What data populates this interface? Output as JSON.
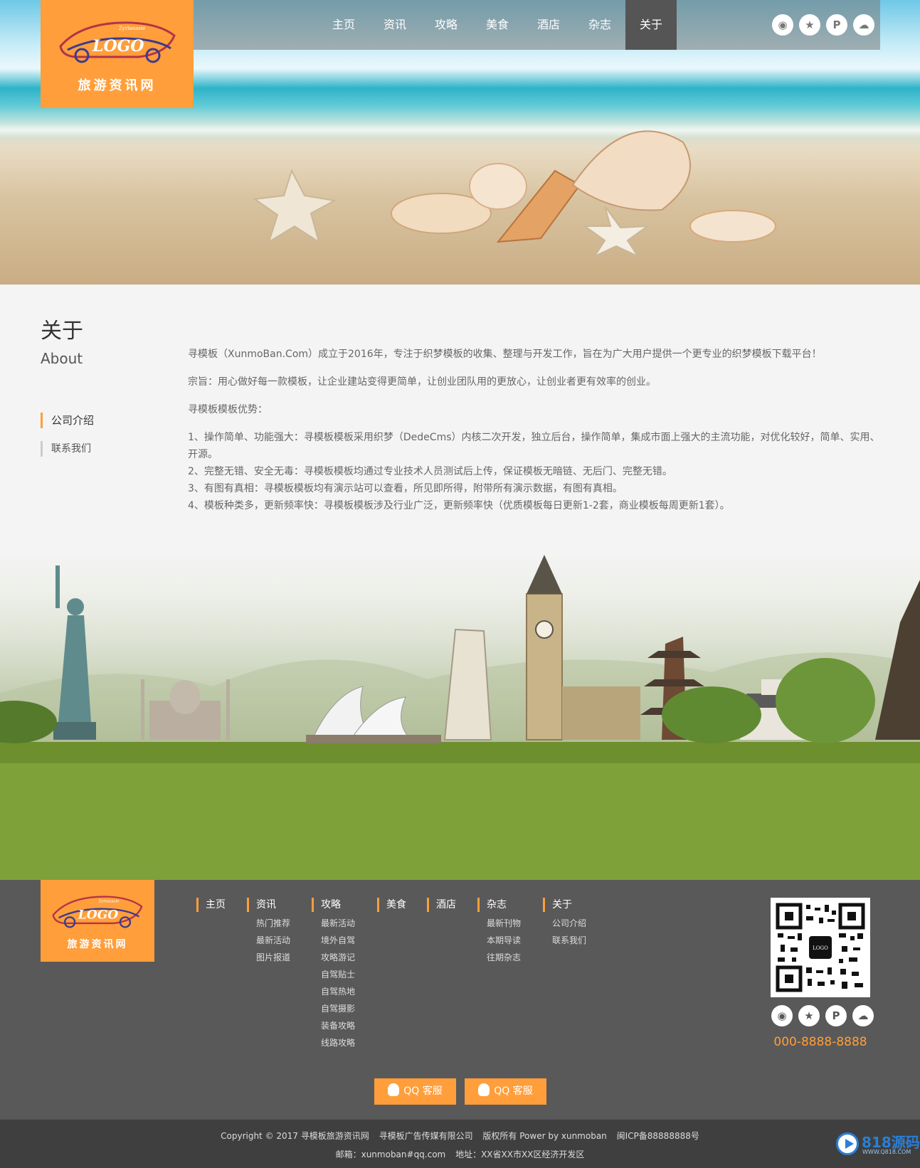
{
  "brand": {
    "logo_text": "LOGO",
    "logo_subtext": "Zyrlanasie",
    "site_name": "旅游资讯网",
    "accent_color": "#ff9e3a"
  },
  "nav": {
    "items": [
      {
        "label": "主页"
      },
      {
        "label": "资讯"
      },
      {
        "label": "攻略"
      },
      {
        "label": "美食"
      },
      {
        "label": "酒店"
      },
      {
        "label": "杂志"
      },
      {
        "label": "关于",
        "active": true
      }
    ]
  },
  "social": [
    {
      "icon": "weibo-icon",
      "glyph": "◉"
    },
    {
      "icon": "star-icon",
      "glyph": "★"
    },
    {
      "icon": "tieba-icon",
      "glyph": "P"
    },
    {
      "icon": "wechat-icon",
      "glyph": "☁"
    }
  ],
  "sidebar": {
    "title": "关于",
    "subtitle": "About",
    "menu": [
      {
        "label": "公司介绍",
        "active": true
      },
      {
        "label": "联系我们"
      }
    ]
  },
  "article": {
    "p1": "寻模板（XunmoBan.Com）成立于2016年，专注于织梦模板的收集、整理与开发工作，旨在为广大用户提供一个更专业的织梦模板下载平台！",
    "p2": "宗旨：用心做好每一款模板，让企业建站变得更简单，让创业团队用的更放心，让创业者更有效率的创业。",
    "p3": "寻模板模板优势：",
    "list": [
      "1、操作简单、功能强大：寻模板模板采用织梦（DedeCms）内核二次开发，独立后台，操作简单，集成市面上强大的主流功能，对优化较好，简单、实用、开源。",
      "2、完整无错、安全无毒：寻模板模板均通过专业技术人员测试后上传，保证模板无暗链、无后门、完整无错。",
      "3、有图有真相：寻模板模板均有演示站可以查看，所见即所得，附带所有演示数据，有图有真相。",
      "4、模板种类多，更新频率快：寻模板模板涉及行业广泛，更新频率快（优质模板每日更新1-2套，商业模板每周更新1套）。"
    ]
  },
  "footer": {
    "columns": [
      {
        "title": "主页",
        "links": []
      },
      {
        "title": "资讯",
        "links": [
          "热门推荐",
          "最新活动",
          "图片报道"
        ]
      },
      {
        "title": "攻略",
        "links": [
          "最新活动",
          "境外自驾",
          "攻略游记",
          "自驾贴士",
          "自驾热地",
          "自驾摄影",
          "装备攻略",
          "线路攻略"
        ]
      },
      {
        "title": "美食",
        "links": []
      },
      {
        "title": "酒店",
        "links": []
      },
      {
        "title": "杂志",
        "links": [
          "最新刊物",
          "本期导读",
          "往期杂志"
        ]
      },
      {
        "title": "关于",
        "links": [
          "公司介绍",
          "联系我们"
        ]
      }
    ],
    "qr_label": "LOGO",
    "phone": "000-8888-8888",
    "qq_buttons": [
      "QQ 客服",
      "QQ 客服"
    ],
    "copyright": [
      "Copyright © 2017 寻模板旅游资讯网",
      "寻模板广告传媒有限公司",
      "版权所有 Power by xunmoban",
      "闽ICP备88888888号"
    ],
    "contact": [
      "邮箱：xunmoban#qq.com",
      "地址：XX省XX市XX区经济开发区"
    ]
  },
  "watermark": {
    "text": "818源码",
    "sub": "WWW.Q818.COM"
  }
}
